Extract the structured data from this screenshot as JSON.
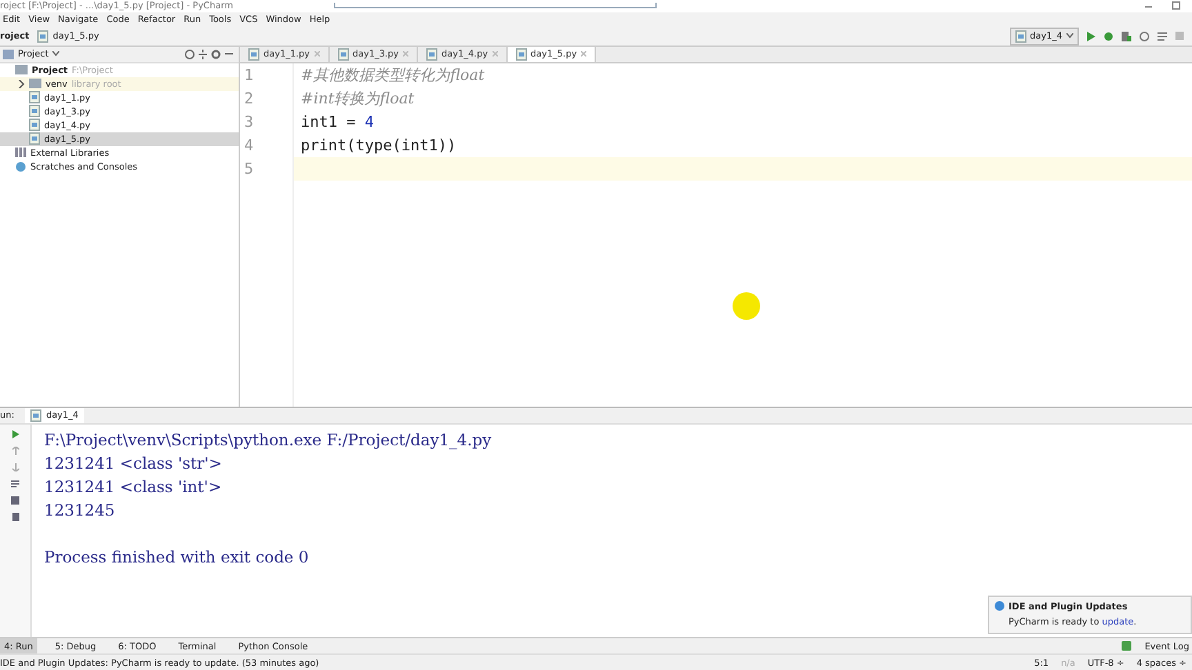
{
  "window": {
    "title": "roject [F:\\Project] - ...\\day1_5.py [Project] - PyCharm"
  },
  "menu": [
    "Edit",
    "View",
    "Navigate",
    "Code",
    "Refactor",
    "Run",
    "Tools",
    "VCS",
    "Window",
    "Help"
  ],
  "breadcrumbs": [
    "roject",
    "day1_5.py"
  ],
  "run_config": "day1_4",
  "project_panel": {
    "title": "Project",
    "tree": [
      {
        "label": "Project",
        "hint": "F:\\Project",
        "kind": "root",
        "selected": false,
        "children": [
          {
            "label": "venv",
            "hint": "library root",
            "kind": "folder",
            "selected": false,
            "expanded": false
          },
          {
            "label": "day1_1.py",
            "kind": "file",
            "selected": false
          },
          {
            "label": "day1_3.py",
            "kind": "file",
            "selected": false
          },
          {
            "label": "day1_4.py",
            "kind": "file",
            "selected": false
          },
          {
            "label": "day1_5.py",
            "kind": "file",
            "selected": true
          }
        ]
      },
      {
        "label": "External Libraries",
        "kind": "library",
        "selected": false
      },
      {
        "label": "Scratches and Consoles",
        "kind": "scratch",
        "selected": false
      }
    ]
  },
  "editor_tabs": [
    {
      "label": "day1_1.py",
      "selected": false
    },
    {
      "label": "day1_3.py",
      "selected": false
    },
    {
      "label": "day1_4.py",
      "selected": false
    },
    {
      "label": "day1_5.py",
      "selected": true
    }
  ],
  "code_lines": [
    {
      "number": "1",
      "current": false,
      "tokens": [
        {
          "kind": "comment",
          "text": "#其他数据类型转化为float"
        }
      ]
    },
    {
      "number": "2",
      "current": false,
      "tokens": [
        {
          "kind": "comment",
          "text": "#int转换为float"
        }
      ]
    },
    {
      "number": "3",
      "current": false,
      "tokens": [
        {
          "kind": "plain",
          "text": "int1 = "
        },
        {
          "kind": "number",
          "text": "4"
        }
      ]
    },
    {
      "number": "4",
      "current": false,
      "tokens": [
        {
          "kind": "plain",
          "text": "print(type(int1))"
        }
      ]
    },
    {
      "number": "5",
      "current": true
    }
  ],
  "run_panel": {
    "label": "un:",
    "tab": "day1_4",
    "output": [
      {
        "kind": "stdout",
        "text": "F:\\Project\\venv\\Scripts\\python.exe F:/Project/day1_4.py"
      },
      {
        "kind": "stdout",
        "text": "1231241 <class 'str'>"
      },
      {
        "kind": "stdout",
        "text": "1231241 <class 'int'>"
      },
      {
        "kind": "stdout",
        "text": "1231245"
      },
      {
        "kind": "exit",
        "text": "Process finished with exit code 0"
      }
    ]
  },
  "notification": {
    "title": "IDE and Plugin Updates",
    "body": "PyCharm is ready to ",
    "link": "update",
    "suffix": "."
  },
  "tool_windows": [
    {
      "label": "4: Run",
      "selected": true
    },
    {
      "label": "5: Debug",
      "selected": false
    },
    {
      "label": "6: TODO",
      "selected": false
    },
    {
      "label": "Terminal",
      "selected": false
    },
    {
      "label": "Python Console",
      "selected": false
    }
  ],
  "event_log": "Event Log",
  "status_bar": {
    "message": "IDE and Plugin Updates: PyCharm is ready to update. (53 minutes ago)",
    "items": [
      "5:1",
      "n/a",
      "UTF-8 ÷",
      "4 spaces ÷"
    ]
  }
}
